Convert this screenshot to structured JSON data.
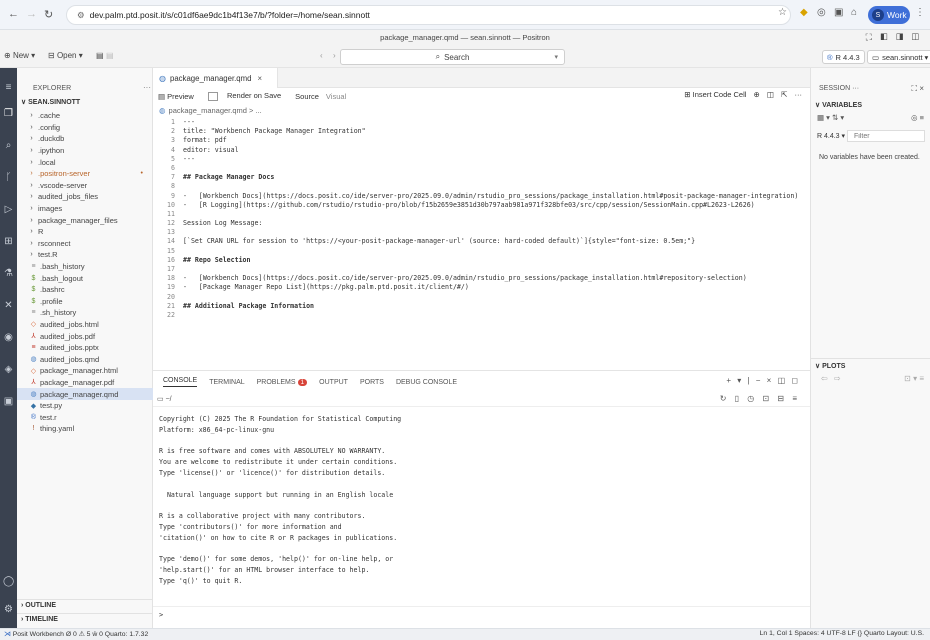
{
  "browser": {
    "url": "dev.palm.ptd.posit.it/s/c01df6ae9dc1b4f13e7/b/?folder=/home/sean.sinnott",
    "profile_label": "Work",
    "profile_initial": "S"
  },
  "window": {
    "title": "package_manager.qmd — sean.sinnott — Positron"
  },
  "toolbar": {
    "new_label": "New",
    "open_label": "Open",
    "search_label": "Search",
    "r_version": "R 4.4.3",
    "user": "sean.sinnott"
  },
  "explorer": {
    "header": "EXPLORER",
    "root": "SEAN.SINNOTT",
    "items": [
      {
        "label": ".cache",
        "type": "folder"
      },
      {
        "label": ".config",
        "type": "folder"
      },
      {
        "label": ".duckdb",
        "type": "folder"
      },
      {
        "label": ".ipython",
        "type": "folder"
      },
      {
        "label": ".local",
        "type": "folder"
      },
      {
        "label": ".positron-server",
        "type": "folder"
      },
      {
        "label": ".vscode-server",
        "type": "folder"
      },
      {
        "label": "audited_jobs_files",
        "type": "folder"
      },
      {
        "label": "images",
        "type": "folder"
      },
      {
        "label": "package_manager_files",
        "type": "folder"
      },
      {
        "label": "R",
        "type": "folder"
      },
      {
        "label": "rsconnect",
        "type": "folder"
      },
      {
        "label": "test.R",
        "type": "folder"
      },
      {
        "label": ".bash_history",
        "type": "file"
      },
      {
        "label": ".bash_logout",
        "type": "file"
      },
      {
        "label": ".bashrc",
        "type": "file"
      },
      {
        "label": ".profile",
        "type": "file"
      },
      {
        "label": ".sh_history",
        "type": "file"
      },
      {
        "label": "audited_jobs.html",
        "type": "file"
      },
      {
        "label": "audited_jobs.pdf",
        "type": "file"
      },
      {
        "label": "audited_jobs.pptx",
        "type": "file"
      },
      {
        "label": "audited_jobs.qmd",
        "type": "file"
      },
      {
        "label": "package_manager.html",
        "type": "file"
      },
      {
        "label": "package_manager.pdf",
        "type": "file"
      },
      {
        "label": "package_manager.qmd",
        "type": "file"
      },
      {
        "label": "test.py",
        "type": "file"
      },
      {
        "label": "test.r",
        "type": "file"
      },
      {
        "label": "thing.yaml",
        "type": "file"
      }
    ],
    "outline": "OUTLINE",
    "timeline": "TIMELINE"
  },
  "editor": {
    "tab_label": "package_manager.qmd",
    "tools": {
      "preview": "Preview",
      "render_on_save": "Render on Save",
      "source": "Source",
      "visual": "Visual",
      "insert_code_cell": "Insert Code Cell"
    },
    "breadcrumb": "package_manager.qmd > ...",
    "lines": [
      {
        "n": "1",
        "text": "---"
      },
      {
        "n": "2",
        "text": "title: \"Workbench Package Manager Integration\""
      },
      {
        "n": "3",
        "text": "format: pdf"
      },
      {
        "n": "4",
        "text": "editor: visual"
      },
      {
        "n": "5",
        "text": "---"
      },
      {
        "n": "6",
        "text": ""
      },
      {
        "n": "7",
        "text": "## Package Manager Docs",
        "heading": true
      },
      {
        "n": "8",
        "text": ""
      },
      {
        "n": "9",
        "text": "-   [Workbench Docs](https://docs.posit.co/ide/server-pro/2025.09.0/admin/rstudio_pro_sessions/package_installation.html#posit-package-manager-integration)"
      },
      {
        "n": "10",
        "text": "-   [R Logging](https://github.com/rstudio/rstudio-pro/blob/f15b2659e3851d30b797aab981a971f328bfe03/src/cpp/session/SessionMain.cpp#L2623-L2626)"
      },
      {
        "n": "11",
        "text": ""
      },
      {
        "n": "12",
        "text": "Session Log Message:"
      },
      {
        "n": "13",
        "text": ""
      },
      {
        "n": "14",
        "text": "[`Set CRAN URL for session to 'https://<your-posit-package-manager-url' (source: hard-coded default)`]{style=\"font-size: 0.5em;\"}"
      },
      {
        "n": "15",
        "text": ""
      },
      {
        "n": "16",
        "text": "## Repo Selection",
        "heading": true
      },
      {
        "n": "17",
        "text": ""
      },
      {
        "n": "18",
        "text": "-   [Workbench Docs](https://docs.posit.co/ide/server-pro/2025.09.0/admin/rstudio_pro_sessions/package_installation.html#repository-selection)"
      },
      {
        "n": "19",
        "text": "-   [Package Manager Repo List](https://pkg.palm.ptd.posit.it/client/#/)"
      },
      {
        "n": "20",
        "text": ""
      },
      {
        "n": "21",
        "text": "## Additional Package Information",
        "heading": true
      },
      {
        "n": "22",
        "text": ""
      }
    ]
  },
  "panel": {
    "tabs": [
      "CONSOLE",
      "TERMINAL",
      "PROBLEMS",
      "OUTPUT",
      "PORTS",
      "DEBUG CONSOLE"
    ],
    "problems_count": "1",
    "console_path": "~/",
    "console_lines": [
      "Copyright (C) 2025 The R Foundation for Statistical Computing",
      "Platform: x86_64-pc-linux-gnu",
      "",
      "R is free software and comes with ABSOLUTELY NO WARRANTY.",
      "You are welcome to redistribute it under certain conditions.",
      "Type 'license()' or 'licence()' for distribution details.",
      "",
      "  Natural language support but running in an English locale",
      "",
      "R is a collaborative project with many contributors.",
      "Type 'contributors()' for more information and",
      "'citation()' on how to cite R or R packages in publications.",
      "",
      "Type 'demo()' for some demos, 'help()' for on-line help, or",
      "'help.start()' for an HTML browser interface to help.",
      "Type 'q()' to quit R."
    ],
    "prompt": ">"
  },
  "session": {
    "header": "SESSION",
    "variables": "VARIABLES",
    "r_select": "R 4.4.3",
    "filter_placeholder": "Filter",
    "no_vars": "No variables have been created.",
    "plots": "PLOTS"
  },
  "statusbar": {
    "left": "Posit Workbench    Ø 0 ⚠ 5   ŵ 0   Quarto: 1.7.32",
    "right": "Ln 1, Col 1   Spaces: 4   UTF-8   LF   {} Quarto   Layout: U.S."
  }
}
